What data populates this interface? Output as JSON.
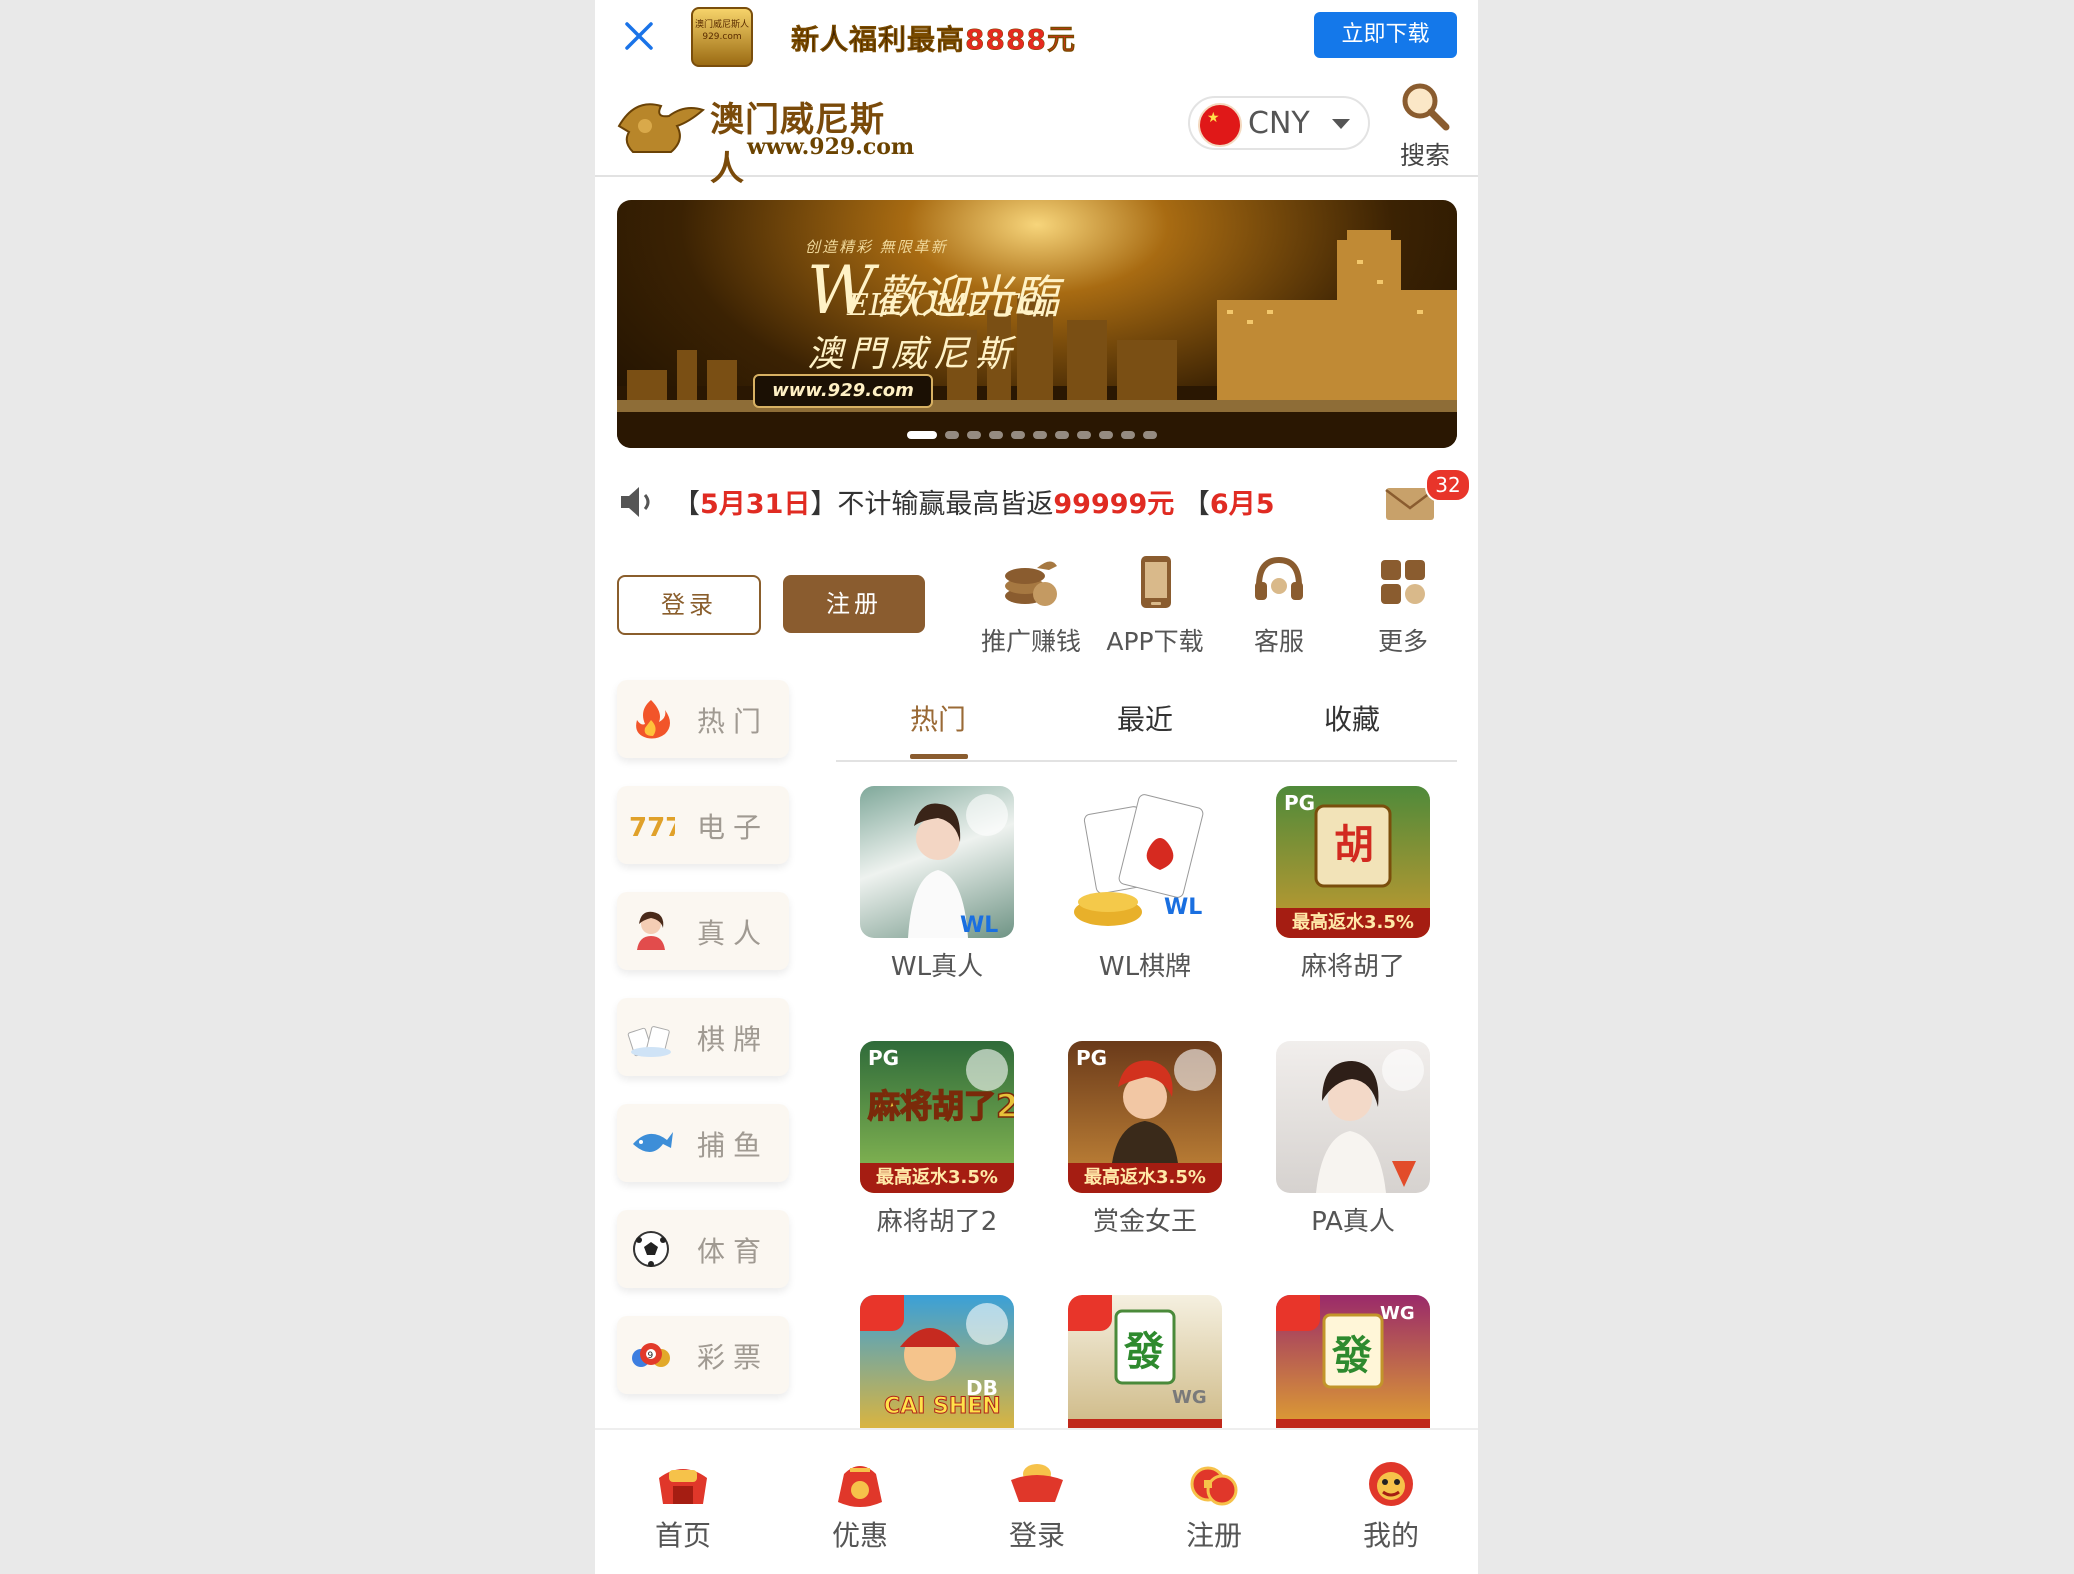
{
  "download_bar": {
    "app_logo_text": "澳门威尼斯人 929.com",
    "promo_prefix": "新人福利最高",
    "promo_amount": "8888元",
    "download_button": "立即下载"
  },
  "header": {
    "brand_name": "澳门威尼斯人",
    "brand_url": "www.929.com",
    "currency": "CNY",
    "search_label": "搜索"
  },
  "banner": {
    "tagline": "创造精彩 無限革新",
    "welcome_cn": "歡迎光臨",
    "welcome_en": "ELCOME TO",
    "welcome_w": "W",
    "venue": "澳門威尼斯",
    "url": "www.929.com",
    "slide_count": 11,
    "active_slide": 1
  },
  "marquee": {
    "segments": [
      {
        "text": "【",
        "red": false
      },
      {
        "text": "5月31日",
        "red": true
      },
      {
        "text": "】不计输赢最高皆返",
        "red": false
      },
      {
        "text": "99999元",
        "red": true
      },
      {
        "text": " 【",
        "red": false
      },
      {
        "text": "6月5",
        "red": true
      }
    ],
    "mail_badge": "32"
  },
  "auth": {
    "login": "登录",
    "register": "注册"
  },
  "quick_links": [
    {
      "label": "推广赚钱",
      "icon": "coins-icon"
    },
    {
      "label": "APP下载",
      "icon": "phone-icon"
    },
    {
      "label": "客服",
      "icon": "headset-icon"
    },
    {
      "label": "更多",
      "icon": "grid-icon"
    }
  ],
  "categories": [
    {
      "label": "热门",
      "icon": "flame-icon"
    },
    {
      "label": "电子",
      "icon": "slot-777-icon"
    },
    {
      "label": "真人",
      "icon": "live-dealer-icon"
    },
    {
      "label": "棋牌",
      "icon": "cards-icon"
    },
    {
      "label": "捕鱼",
      "icon": "fish-icon"
    },
    {
      "label": "体育",
      "icon": "soccer-ball-icon"
    },
    {
      "label": "彩票",
      "icon": "lottery-ball-icon"
    }
  ],
  "tabs": [
    {
      "label": "热门",
      "active": true
    },
    {
      "label": "最近",
      "active": false
    },
    {
      "label": "收藏",
      "active": false
    }
  ],
  "games": [
    {
      "name": "WL真人",
      "rebate": "",
      "like": false,
      "provider": "WL"
    },
    {
      "name": "WL棋牌",
      "rebate": "",
      "like": false,
      "provider": "WL"
    },
    {
      "name": "麻将胡了",
      "rebate": "最高返水3.5%",
      "like": false,
      "provider": "PG"
    },
    {
      "name": "麻将胡了2",
      "rebate": "最高返水3.5%",
      "like": false,
      "provider": "PG"
    },
    {
      "name": "赏金女王",
      "rebate": "最高返水3.5%",
      "like": false,
      "provider": "PG"
    },
    {
      "name": "PA真人",
      "rebate": "",
      "like": false,
      "provider": "PA"
    },
    {
      "name": "",
      "rebate": "",
      "like": true,
      "provider": "DB"
    },
    {
      "name": "",
      "rebate": "",
      "like": true,
      "provider": "WG"
    },
    {
      "name": "",
      "rebate": "",
      "like": true,
      "provider": "WG"
    }
  ],
  "bottom_nav": [
    {
      "label": "首页",
      "icon": "home-icon"
    },
    {
      "label": "优惠",
      "icon": "promo-bag-icon"
    },
    {
      "label": "登录",
      "icon": "ingot-icon"
    },
    {
      "label": "注册",
      "icon": "coins-red-icon"
    },
    {
      "label": "我的",
      "icon": "lion-mascot-icon"
    }
  ],
  "colors": {
    "brand_brown": "#8a5c2f",
    "download_blue": "#1478ea",
    "alert_red": "#e8352a",
    "tab_active": "#9a6a36"
  }
}
